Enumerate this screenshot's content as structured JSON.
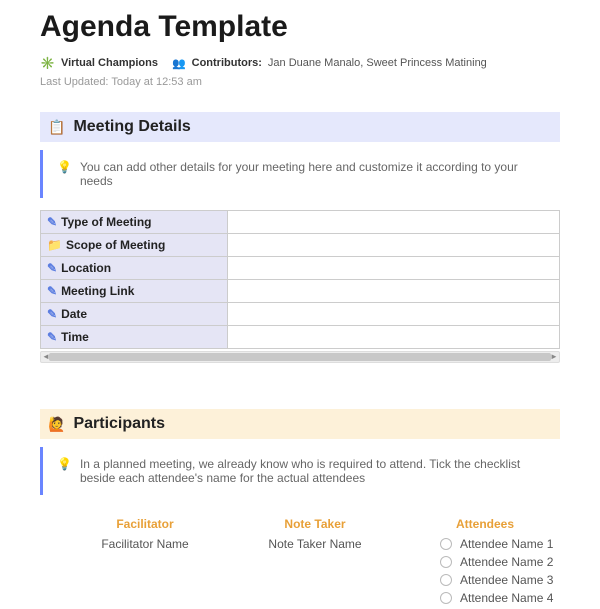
{
  "title": "Agenda Template",
  "meta": {
    "workspace": "Virtual Champions",
    "contributors_label": "Contributors:",
    "contributors_names": "Jan Duane Manalo, Sweet Princess Matining",
    "last_updated_label": "Last Updated:",
    "last_updated_value": "Today at 12:53 am"
  },
  "details": {
    "header": "Meeting Details",
    "hint": "You can add other details for your meeting here and customize it according to your needs",
    "rows": [
      {
        "icon": "pen",
        "label": "Type of Meeting",
        "value": ""
      },
      {
        "icon": "folder",
        "label": "Scope of Meeting",
        "value": ""
      },
      {
        "icon": "pen",
        "label": "Location",
        "value": ""
      },
      {
        "icon": "pen",
        "label": "Meeting Link",
        "value": ""
      },
      {
        "icon": "pen",
        "label": "Date",
        "value": ""
      },
      {
        "icon": "pen",
        "label": "Time",
        "value": ""
      }
    ]
  },
  "participants": {
    "header": "Participants",
    "hint": "In a planned meeting, we already know who is required to attend. Tick the checklist beside each attendee's name for the actual attendees",
    "cols": {
      "facilitator": {
        "header": "Facilitator",
        "value": "Facilitator Name"
      },
      "note_taker": {
        "header": "Note Taker",
        "value": "Note Taker Name"
      },
      "attendees": {
        "header": "Attendees",
        "items": [
          "Attendee Name 1",
          "Attendee Name 2",
          "Attendee Name 3",
          "Attendee Name 4"
        ]
      }
    }
  }
}
